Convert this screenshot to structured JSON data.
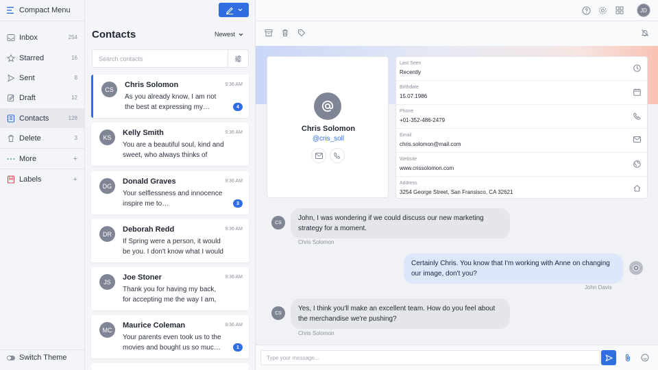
{
  "app": {
    "menu_label": "Compact Menu"
  },
  "sidebar": {
    "items": [
      {
        "label": "Inbox",
        "count": "254"
      },
      {
        "label": "Starred",
        "count": "16"
      },
      {
        "label": "Sent",
        "count": "8"
      },
      {
        "label": "Draft",
        "count": "12"
      },
      {
        "label": "Contacts",
        "count": "128"
      },
      {
        "label": "Delete",
        "count": "3"
      },
      {
        "label": "More",
        "count": "+"
      },
      {
        "label": "Labels",
        "count": "+"
      }
    ],
    "switch_theme": "Switch Theme"
  },
  "contacts": {
    "title": "Contacts",
    "sort": "Newest",
    "search_placeholder": "Search contacts",
    "list": [
      {
        "initials": "CS",
        "name": "Chris Solomon",
        "time": "9:36 AM",
        "snippet": "As you already know, I am not the best at expressing my…",
        "badge": "4"
      },
      {
        "initials": "KS",
        "name": "Kelly Smith",
        "time": "9:36 AM",
        "snippet": "You are a beautiful soul, kind and sweet, who always thinks of others…",
        "badge": ""
      },
      {
        "initials": "DG",
        "name": "Donald Graves",
        "time": "9:36 AM",
        "snippet": "Your selflessness and innocence inspire me to…",
        "badge": "3"
      },
      {
        "initials": "DR",
        "name": "Deborah Redd",
        "time": "9:36 AM",
        "snippet": "If Spring were a person, it would be you. I don't know what I would do…",
        "badge": ""
      },
      {
        "initials": "JS",
        "name": "Joe Stoner",
        "time": "9:36 AM",
        "snippet": "Thank you for having my back, for accepting me the way I am, for neve…",
        "badge": ""
      },
      {
        "initials": "MC",
        "name": "Maurice Coleman",
        "time": "9:36 AM",
        "snippet": "Your parents even took us to the movies and bought us so muc…",
        "badge": "1"
      }
    ]
  },
  "topbar": {
    "user_initials": "JD"
  },
  "profile": {
    "name": "Chris Solomon",
    "handle": "@cris_soll",
    "fields": [
      {
        "label": "Last Seen",
        "value": "Recently",
        "icon": "clock-icon"
      },
      {
        "label": "Birthdate",
        "value": "15.07.1986",
        "icon": "calendar-icon"
      },
      {
        "label": "Phone",
        "value": "+01-352-486-2479",
        "icon": "phone-icon"
      },
      {
        "label": "Email",
        "value": "chris.solomon@mail.com",
        "icon": "mail-icon"
      },
      {
        "label": "Website",
        "value": "www.crissolomon.com",
        "icon": "globe-icon"
      },
      {
        "label": "Address",
        "value": "3254 George Street, San Fransisco, CA 32621",
        "icon": "home-icon"
      }
    ]
  },
  "chat": {
    "messages": [
      {
        "direction": "in",
        "initials": "CS",
        "text": "John, I was wondering if we could discuss our new marketing strategy for a moment.",
        "sender": "Chris Solomon"
      },
      {
        "direction": "out",
        "initials": "",
        "text": "Certainly Chris. You know that I'm working with Anne on changing our image, don't you?",
        "sender": "John Davis"
      },
      {
        "direction": "in",
        "initials": "CS",
        "text": "Yes, I think you'll make an excellent team. How do you feel about the merchandise we're pushing?",
        "sender": "Chris Solomon"
      }
    ],
    "input_placeholder": "Type your message..."
  },
  "colors": {
    "accent": "#2f6de0",
    "sidebar_bg": "#f4f5f8",
    "bubble_in": "#e4e6ea",
    "bubble_out": "#dce7fb"
  }
}
